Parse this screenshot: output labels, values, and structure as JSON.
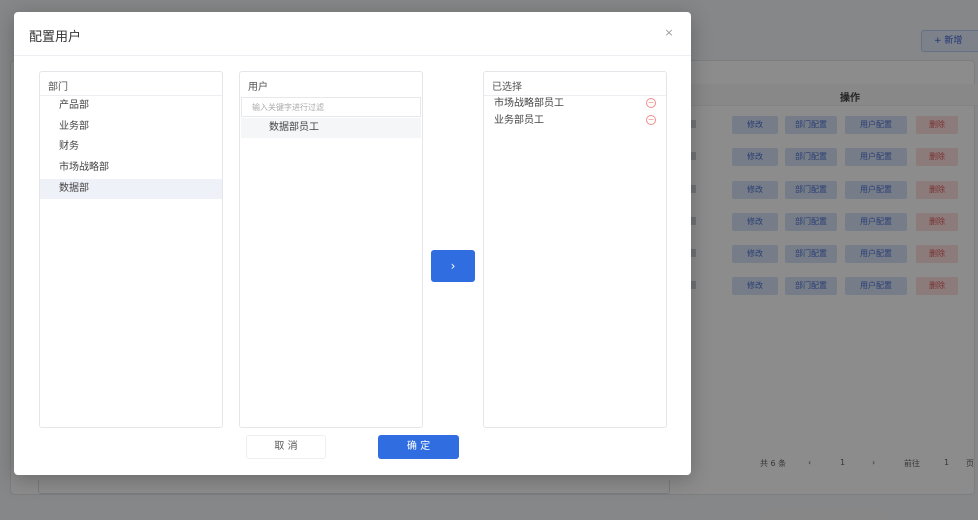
{
  "background": {
    "add_button_label": "+ 新增",
    "table_header": "操作",
    "row_actions": [
      {
        "edit": "修改",
        "dept_config": "部门配置",
        "user_config": "用户配置",
        "delete": "删除"
      },
      {
        "edit": "修改",
        "dept_config": "部门配置",
        "user_config": "用户配置",
        "delete": "删除"
      },
      {
        "edit": "修改",
        "dept_config": "部门配置",
        "user_config": "用户配置",
        "delete": "删除"
      },
      {
        "edit": "修改",
        "dept_config": "部门配置",
        "user_config": "用户配置",
        "delete": "删除"
      },
      {
        "edit": "修改",
        "dept_config": "部门配置",
        "user_config": "用户配置",
        "delete": "删除"
      },
      {
        "edit": "修改",
        "dept_config": "部门配置",
        "user_config": "用户配置",
        "delete": "删除"
      }
    ],
    "pager": {
      "total": "共 6 条",
      "prev": "‹",
      "current": "1",
      "next": "›",
      "goto": "前往",
      "goto_value": "1",
      "page_suffix": "页"
    }
  },
  "modal": {
    "title": "配置用户",
    "close": "×",
    "department_panel": {
      "title": "部门",
      "items": [
        "产品部",
        "业务部",
        "财务",
        "市场战略部",
        "数据部"
      ],
      "selected_index": 4
    },
    "user_panel": {
      "title": "用户",
      "search_placeholder": "输入关键字进行过滤",
      "items": [
        "数据部员工"
      ]
    },
    "transfer_button": "›",
    "selected_panel": {
      "title": "已选择",
      "items": [
        "市场战略部员工",
        "业务部员工"
      ],
      "remove_icon": "−"
    },
    "cancel_label": "取 消",
    "confirm_label": "确 定"
  }
}
